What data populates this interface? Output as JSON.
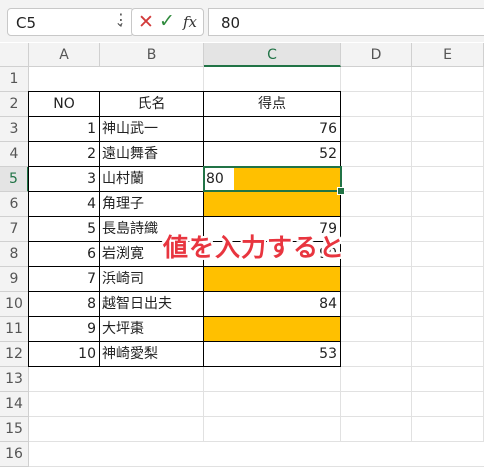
{
  "formula_bar": {
    "name_box": "C5",
    "formula": "80"
  },
  "columns": [
    "A",
    "B",
    "C",
    "D",
    "E"
  ],
  "rows": [
    "1",
    "2",
    "3",
    "4",
    "5",
    "6",
    "7",
    "8",
    "9",
    "10",
    "11",
    "12",
    "13",
    "14",
    "15",
    "16"
  ],
  "table": {
    "headers": {
      "no": "NO",
      "name": "氏名",
      "score": "得点"
    },
    "records": [
      {
        "no": "1",
        "name": "神山武一",
        "score": "76",
        "highlight": false
      },
      {
        "no": "2",
        "name": "遠山舞香",
        "score": "52",
        "highlight": false
      },
      {
        "no": "3",
        "name": "山村蘭",
        "score": "80",
        "highlight": true
      },
      {
        "no": "4",
        "name": "角理子",
        "score": "",
        "highlight": true
      },
      {
        "no": "5",
        "name": "長島詩織",
        "score": "79",
        "highlight": false
      },
      {
        "no": "6",
        "name": "岩渕寛",
        "score": "90",
        "highlight": false
      },
      {
        "no": "7",
        "name": "浜崎司",
        "score": "",
        "highlight": true
      },
      {
        "no": "8",
        "name": "越智日出夫",
        "score": "84",
        "highlight": false
      },
      {
        "no": "9",
        "name": "大坪棗",
        "score": "",
        "highlight": true
      },
      {
        "no": "10",
        "name": "神崎愛梨",
        "score": "53",
        "highlight": false
      }
    ]
  },
  "active_cell": "C5",
  "annotation": "値を入力すると",
  "colors": {
    "highlight": "#ffc000",
    "accent": "#217346",
    "annotation": "#e8353f"
  },
  "icons": [
    "chevron-down-icon",
    "more-dots-icon",
    "cancel-icon",
    "enter-check-icon",
    "function-fx-icon"
  ]
}
